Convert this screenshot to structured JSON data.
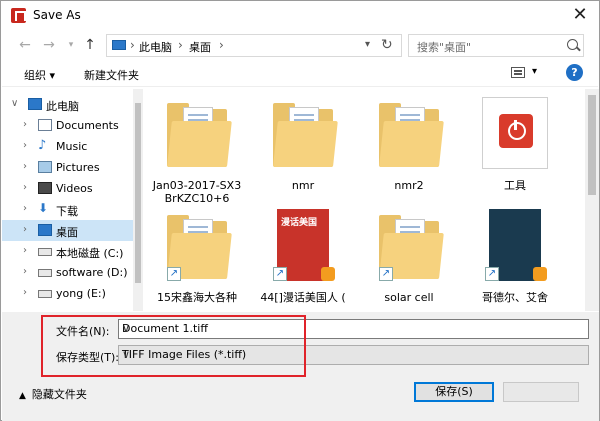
{
  "window": {
    "title": "Save As",
    "close": "✕"
  },
  "nav_icons": {
    "back": "arrow-left-icon",
    "forward": "arrow-right-icon",
    "recent": "chevron-down-icon",
    "up": "arrow-up-icon"
  },
  "address": {
    "segments": [
      "此电脑",
      "桌面"
    ]
  },
  "search": {
    "placeholder": "搜索\"桌面\""
  },
  "toolbar": {
    "organize": "组织 ▾",
    "new_folder": "新建文件夹",
    "help": "?"
  },
  "sidebar": {
    "items": [
      {
        "label": "此电脑",
        "icon": "pc-icon",
        "level": 0,
        "expanded": true
      },
      {
        "label": "Documents",
        "icon": "documents-icon",
        "level": 1
      },
      {
        "label": "Music",
        "icon": "music-icon",
        "level": 1
      },
      {
        "label": "Pictures",
        "icon": "pictures-icon",
        "level": 1
      },
      {
        "label": "Videos",
        "icon": "videos-icon",
        "level": 1
      },
      {
        "label": "下载",
        "icon": "download-icon",
        "level": 1
      },
      {
        "label": "桌面",
        "icon": "desktop-icon",
        "level": 1,
        "selected": true
      },
      {
        "label": "本地磁盘 (C:)",
        "icon": "drive-icon",
        "level": 1
      },
      {
        "label": "software (D:)",
        "icon": "drive-icon",
        "level": 1
      },
      {
        "label": "yong (E:)",
        "icon": "drive-icon",
        "level": 1
      }
    ]
  },
  "files": [
    {
      "label": "Jan03-2017-SX3",
      "label2": "BrKZC10+6",
      "kind": "folder"
    },
    {
      "label": "nmr",
      "kind": "folder"
    },
    {
      "label": "nmr2",
      "kind": "folder"
    },
    {
      "label": "工具",
      "kind": "tool"
    },
    {
      "label": "15宋鑫海大各种",
      "kind": "folder-shortcut"
    },
    {
      "label": "44[]漫话美国人 (",
      "kind": "book-shortcut",
      "cover_title": "漫话美国",
      "cover_color": "#c8332a"
    },
    {
      "label": "solar cell",
      "kind": "folder-shortcut"
    },
    {
      "label": "哥德尔、艾舍",
      "kind": "book-shortcut",
      "cover_color": "#1a3a4f"
    }
  ],
  "form": {
    "filename_label": "文件名(N):",
    "filename_value": "Document 1.tiff",
    "type_label": "保存类型(T):",
    "type_value": "TIFF Image Files (*.tiff)"
  },
  "footer": {
    "hide_folders": "隐藏文件夹",
    "save": "保存(S)",
    "cancel": ""
  },
  "colors": {
    "highlight": "#e0232a",
    "selection": "#cce4f7",
    "accent": "#0078d7"
  }
}
